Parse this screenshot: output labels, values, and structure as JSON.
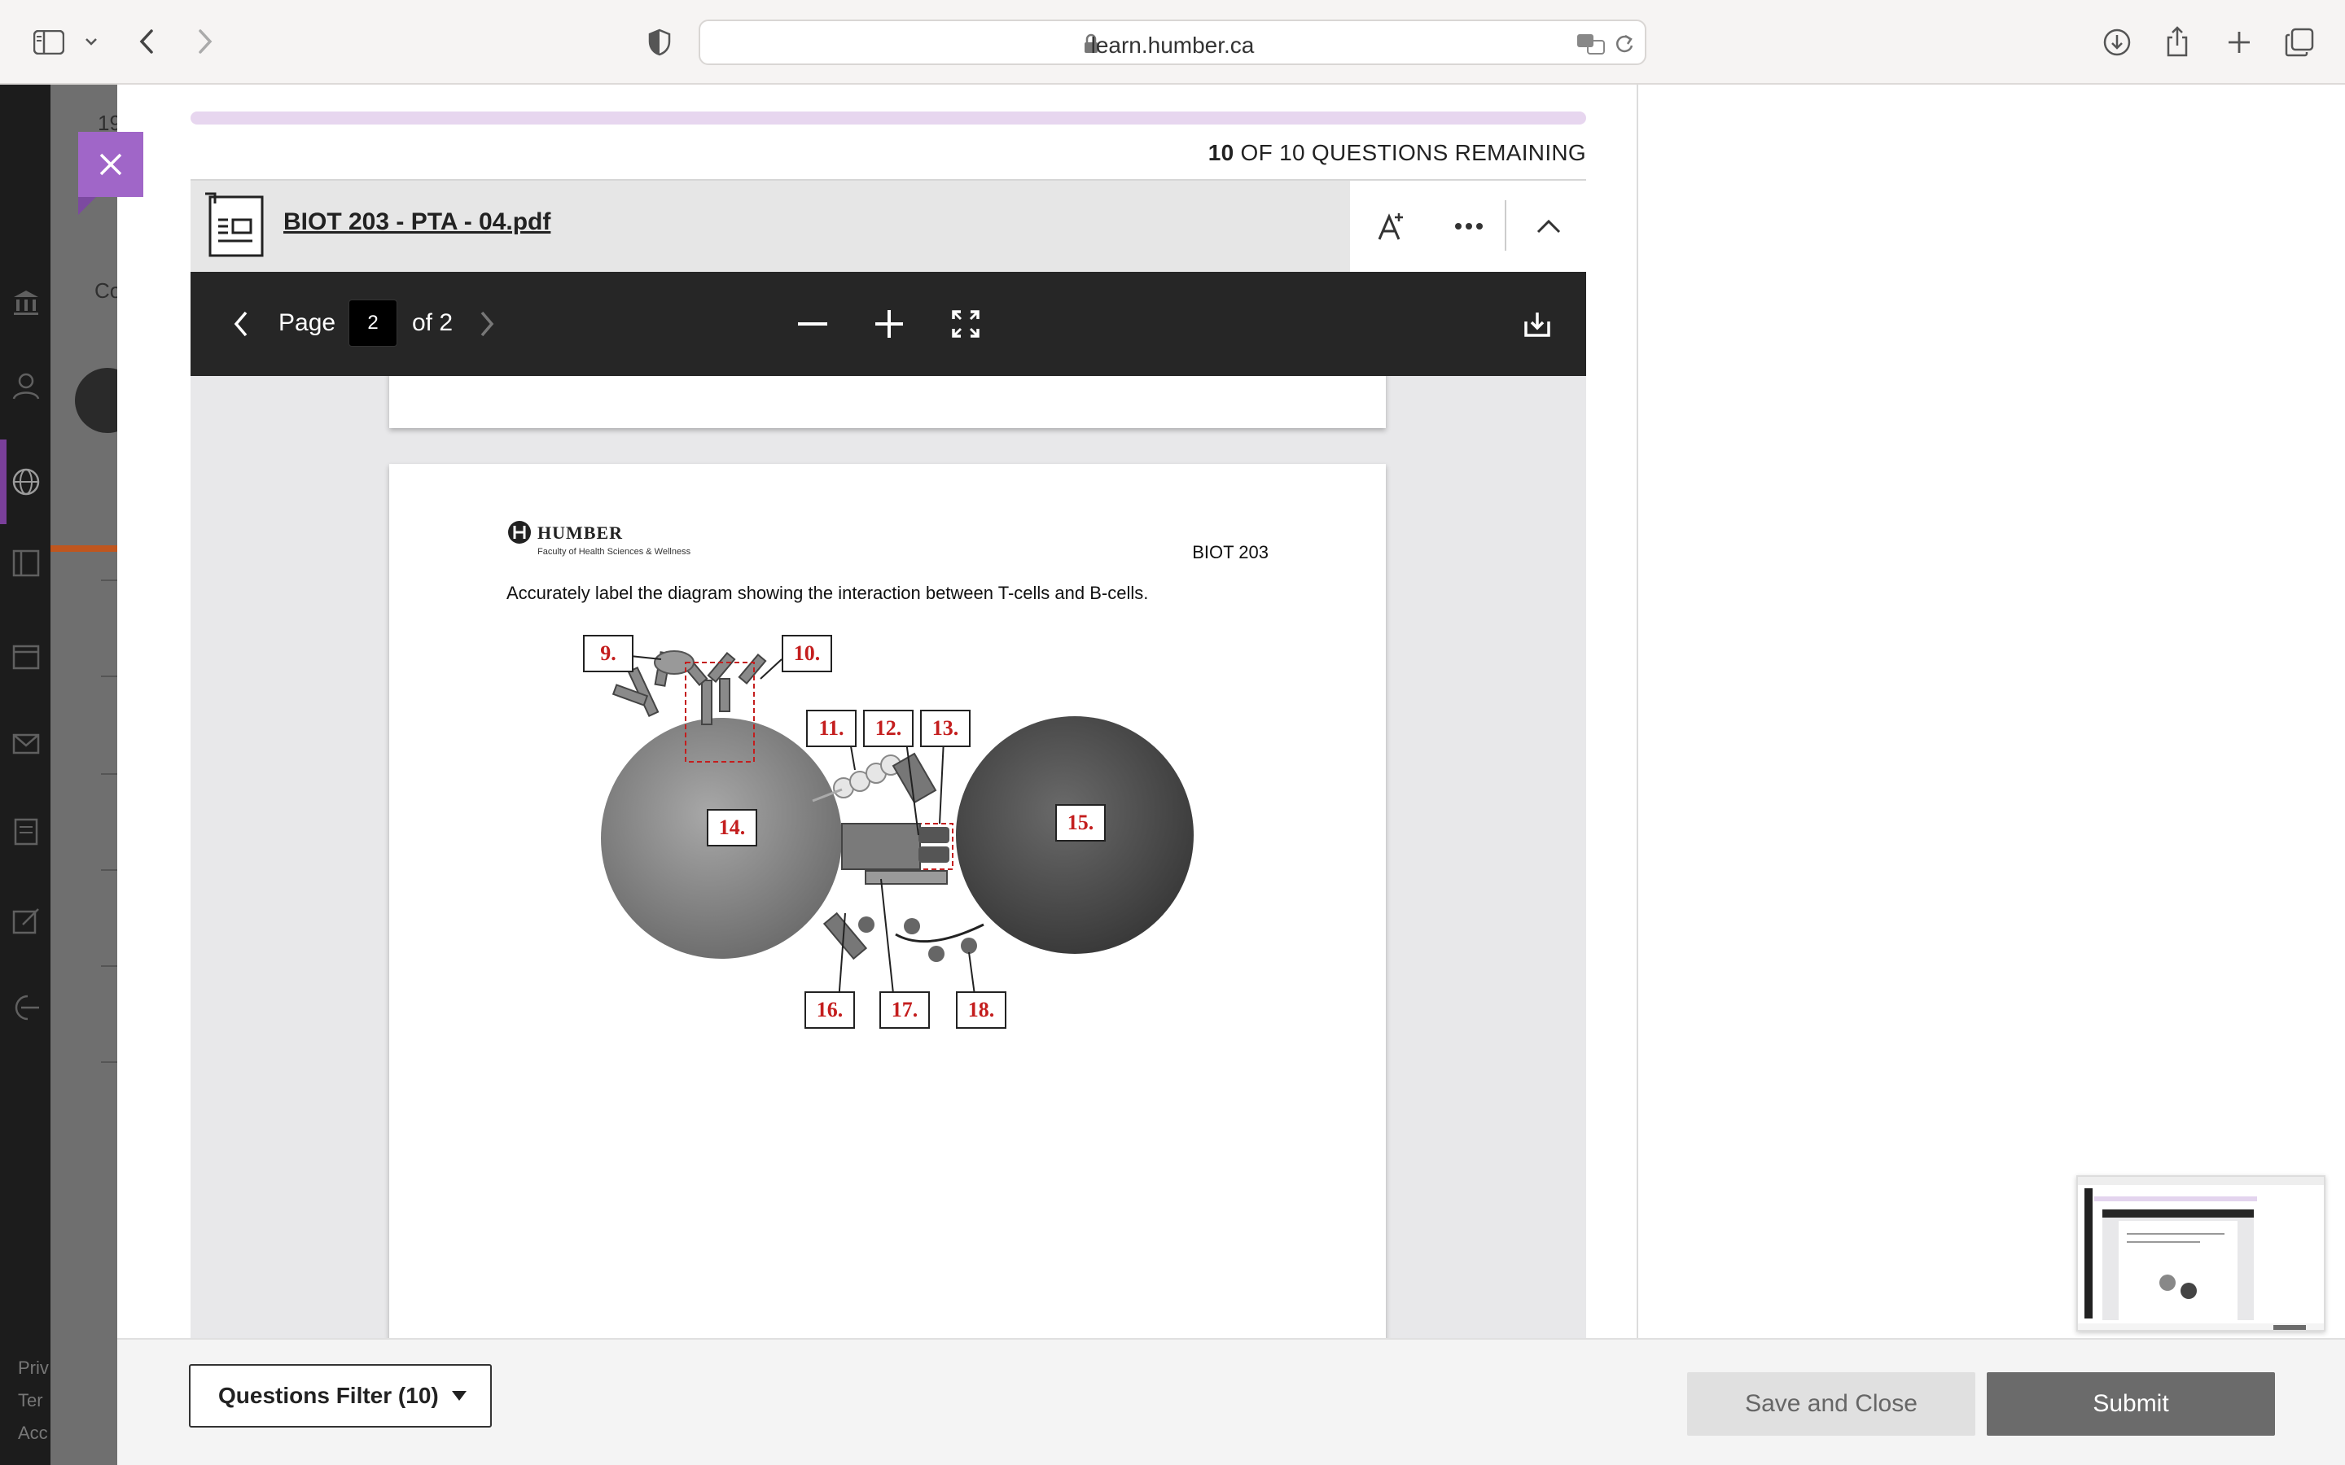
{
  "browser": {
    "url": "learn.humber.ca"
  },
  "background_app": {
    "partial_text_1": "19",
    "partial_text_2": "Co",
    "footer_1": "Priv",
    "footer_2": "Ter",
    "footer_3": "Acc"
  },
  "assessment": {
    "remaining_count": "10",
    "remaining_text": "OF 10 QUESTIONS REMAINING"
  },
  "file": {
    "name": "BIOT 203 - PTA - 04.pdf"
  },
  "pdf_toolbar": {
    "page_label": "Page",
    "current_page": "2",
    "of_total": "of 2"
  },
  "pdf_page": {
    "logo_name": "HUMBER",
    "logo_subtitle": "Faculty of Health Sciences & Wellness",
    "course_code": "BIOT 203",
    "instruction": "Accurately label the diagram showing the interaction between T-cells and B-cells.",
    "labels": [
      "9.",
      "10.",
      "11.",
      "12.",
      "13.",
      "14.",
      "15.",
      "16.",
      "17.",
      "18."
    ]
  },
  "footer": {
    "filter_label": "Questions Filter (10)",
    "save_label": "Save and Close",
    "submit_label": "Submit"
  },
  "colors": {
    "accent_purple": "#a066c8",
    "progress_track": "#e7d6ef",
    "label_red": "#c41e1e",
    "toolbar_dark": "#262626"
  }
}
